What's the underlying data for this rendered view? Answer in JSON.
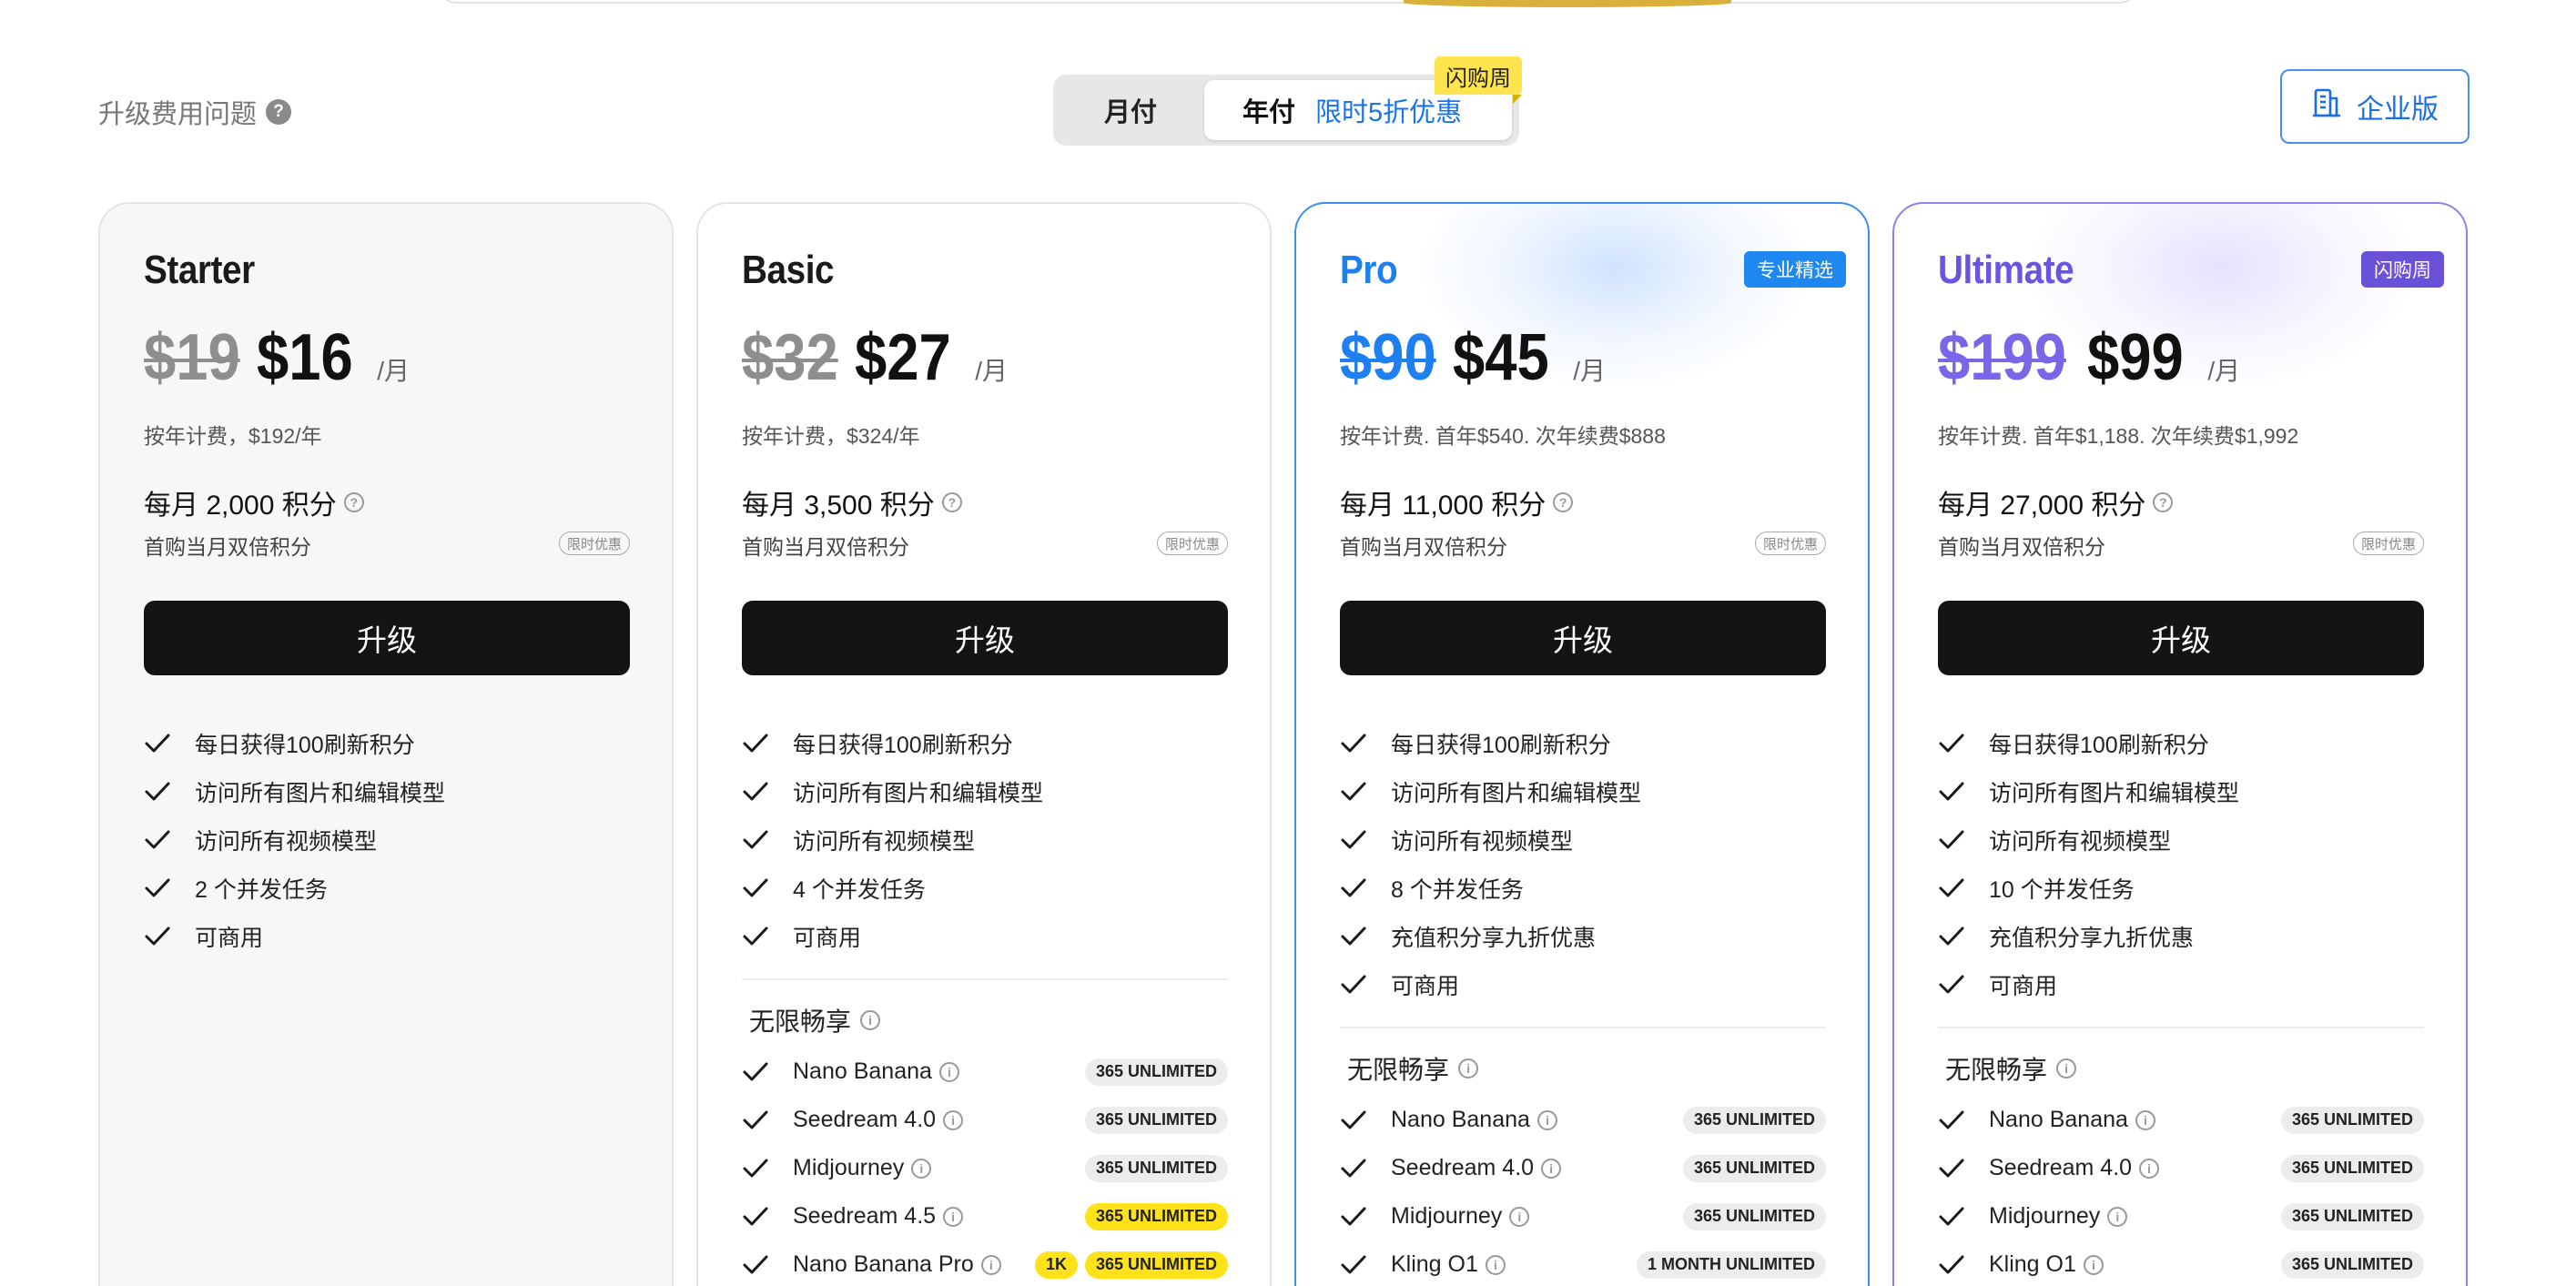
{
  "header": {
    "faq_label": "升级费用问题",
    "faq_icon": "?",
    "toggle_monthly": "月付",
    "toggle_yearly": "年付",
    "toggle_promo": "限时5折优惠",
    "flash_tag": "闪购周",
    "enterprise_label": "企业版"
  },
  "common": {
    "upgrade_label": "升级",
    "per_month": "/月",
    "double_credits": "首购当月双倍积分",
    "limited_offer": "限时优惠",
    "unlimited_title": "无限畅享"
  },
  "plans": [
    {
      "name": "Starter",
      "badge": "",
      "old_price": "$19",
      "new_price": "$16",
      "billing": "按年计费，$192/年",
      "credits": "每月 2,000 积分",
      "features": [
        "每日获得100刷新积分",
        "访问所有图片和编辑模型",
        "访问所有视频模型",
        "2 个并发任务",
        "可商用"
      ],
      "models": []
    },
    {
      "name": "Basic",
      "badge": "",
      "old_price": "$32",
      "new_price": "$27",
      "billing": "按年计费，$324/年",
      "credits": "每月 3,500 积分",
      "features": [
        "每日获得100刷新积分",
        "访问所有图片和编辑模型",
        "访问所有视频模型",
        "4 个并发任务",
        "可商用"
      ],
      "models": [
        {
          "name": "Nano Banana",
          "tags": [
            {
              "text": "365 UNLIMITED",
              "style": "gray"
            }
          ]
        },
        {
          "name": "Seedream 4.0",
          "tags": [
            {
              "text": "365 UNLIMITED",
              "style": "gray"
            }
          ]
        },
        {
          "name": "Midjourney",
          "tags": [
            {
              "text": "365 UNLIMITED",
              "style": "gray"
            }
          ]
        },
        {
          "name": "Seedream 4.5",
          "tags": [
            {
              "text": "365 UNLIMITED",
              "style": "yellow"
            }
          ]
        },
        {
          "name": "Nano Banana Pro",
          "tags": [
            {
              "text": "1K",
              "style": "yellow"
            },
            {
              "text": "365 UNLIMITED",
              "style": "yellow"
            }
          ]
        }
      ]
    },
    {
      "name": "Pro",
      "badge": "专业精选",
      "old_price": "$90",
      "new_price": "$45",
      "billing": "按年计费. 首年$540. 次年续费$888",
      "credits": "每月 11,000 积分",
      "features": [
        "每日获得100刷新积分",
        "访问所有图片和编辑模型",
        "访问所有视频模型",
        "8 个并发任务",
        "充值积分享九折优惠",
        "可商用"
      ],
      "models": [
        {
          "name": "Nano Banana",
          "tags": [
            {
              "text": "365 UNLIMITED",
              "style": "gray"
            }
          ]
        },
        {
          "name": "Seedream 4.0",
          "tags": [
            {
              "text": "365 UNLIMITED",
              "style": "gray"
            }
          ]
        },
        {
          "name": "Midjourney",
          "tags": [
            {
              "text": "365 UNLIMITED",
              "style": "gray"
            }
          ]
        },
        {
          "name": "Kling O1",
          "tags": [
            {
              "text": "1 MONTH UNLIMITED",
              "style": "gray"
            }
          ]
        }
      ]
    },
    {
      "name": "Ultimate",
      "badge": "闪购周",
      "old_price": "$199",
      "new_price": "$99",
      "billing": "按年计费. 首年$1,188. 次年续费$1,992",
      "credits": "每月 27,000 积分",
      "features": [
        "每日获得100刷新积分",
        "访问所有图片和编辑模型",
        "访问所有视频模型",
        "10 个并发任务",
        "充值积分享九折优惠",
        "可商用"
      ],
      "models": [
        {
          "name": "Nano Banana",
          "tags": [
            {
              "text": "365 UNLIMITED",
              "style": "gray"
            }
          ]
        },
        {
          "name": "Seedream 4.0",
          "tags": [
            {
              "text": "365 UNLIMITED",
              "style": "gray"
            }
          ]
        },
        {
          "name": "Midjourney",
          "tags": [
            {
              "text": "365 UNLIMITED",
              "style": "gray"
            }
          ]
        },
        {
          "name": "Kling O1",
          "tags": [
            {
              "text": "365 UNLIMITED",
              "style": "gray"
            }
          ]
        }
      ]
    }
  ],
  "colors": {
    "starter_accent": "#1a1a1a",
    "basic_accent": "#1a1a1a",
    "pro_accent": "#1e7ff0",
    "ultimate_accent": "#6b55e0",
    "starter_old": "#8e8e8e",
    "basic_old": "#8e8e8e",
    "pro_old": "#1e7ff0",
    "ultimate_old": "#7a66e8",
    "pro_badge": "#1e88f0",
    "ultimate_badge": "#6a52d8",
    "promo_blue": "#1a73e8",
    "flash_yellow": "#ffe44d"
  }
}
